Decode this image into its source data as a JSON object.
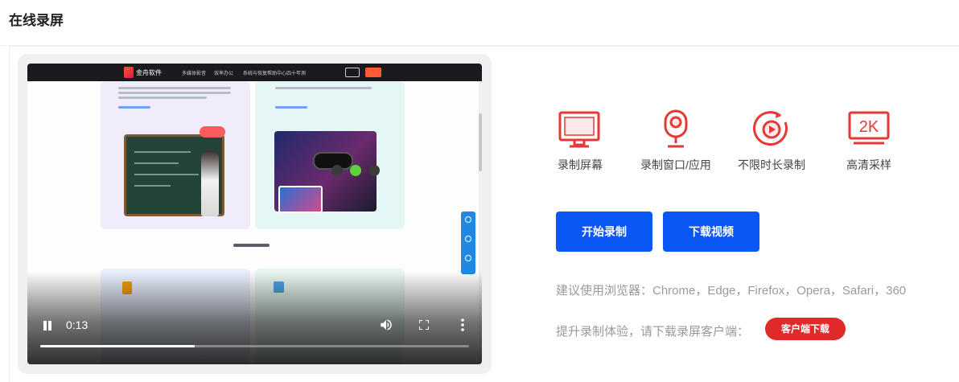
{
  "page": {
    "title": "在线录屏"
  },
  "player": {
    "time": "0:13",
    "progress": 0.36,
    "site_brand": "金舟软件",
    "site_nav": [
      "多媒体影音",
      "效率办公",
      "系统与恢复",
      "帮助中心",
      "四十年测"
    ]
  },
  "features": [
    {
      "label": "录制屏幕",
      "icon": "monitor-icon"
    },
    {
      "label": "录制窗口/应用",
      "icon": "webcam-icon"
    },
    {
      "label": "不限时长录制",
      "icon": "record-play-icon"
    },
    {
      "label": "高清采样",
      "icon": "2k-icon",
      "icon_text": "2K"
    }
  ],
  "buttons": {
    "start": "开始录制",
    "download": "下载视频",
    "client": "客户端下载"
  },
  "tips": {
    "browsers": "建议使用浏览器：Chrome，Edge，Firefox，Opera，Safari，360",
    "client": "提升录制体验，请下载录屏客户端："
  },
  "colors": {
    "accent": "#0a57f5",
    "icon_red": "#e53935",
    "client_button": "#e02a2a"
  }
}
